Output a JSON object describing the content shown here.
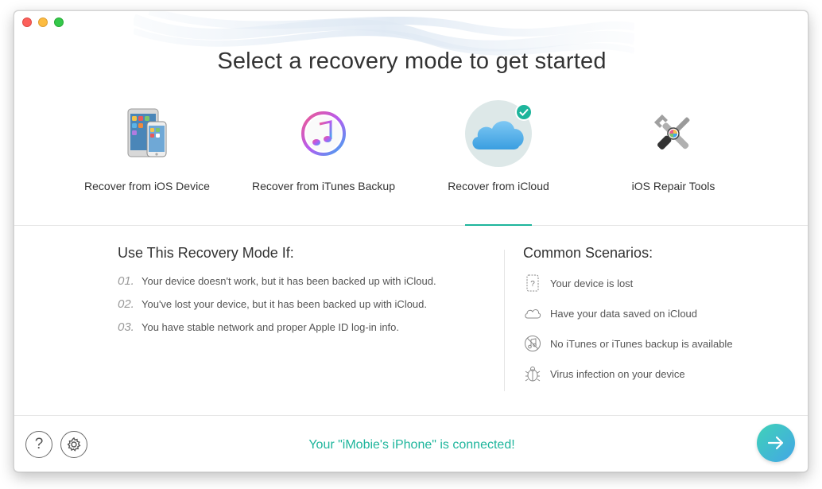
{
  "window": {
    "title": "Select a recovery mode to get started"
  },
  "modes": [
    {
      "label": "Recover from iOS Device",
      "selected": false,
      "icon": "ios-devices-icon"
    },
    {
      "label": "Recover from iTunes Backup",
      "selected": false,
      "icon": "itunes-icon"
    },
    {
      "label": "Recover from iCloud",
      "selected": true,
      "icon": "icloud-icon"
    },
    {
      "label": "iOS Repair Tools",
      "selected": false,
      "icon": "repair-tools-icon"
    }
  ],
  "left": {
    "heading": "Use This Recovery Mode If:",
    "items": [
      {
        "num": "01.",
        "text": "Your device doesn't work, but it has been backed up with iCloud."
      },
      {
        "num": "02.",
        "text": "You've lost your device, but it has been backed up with iCloud."
      },
      {
        "num": "03.",
        "text": "You have stable network and proper Apple ID log-in info."
      }
    ]
  },
  "right": {
    "heading": "Common Scenarios:",
    "items": [
      {
        "icon": "lost-device-icon",
        "text": "Your device is lost"
      },
      {
        "icon": "cloud-icon",
        "text": "Have your data saved on iCloud"
      },
      {
        "icon": "no-itunes-icon",
        "text": "No iTunes or iTunes backup is available"
      },
      {
        "icon": "bug-icon",
        "text": "Virus infection on your device"
      }
    ]
  },
  "footer": {
    "status": "Your \"iMobie's iPhone\" is connected!",
    "help_icon": "question-icon",
    "settings_icon": "gear-icon",
    "next_icon": "arrow-right-icon"
  },
  "colors": {
    "accent": "#1eb59c",
    "next_gradient_start": "#3fd2b8",
    "next_gradient_end": "#43a6e6"
  }
}
